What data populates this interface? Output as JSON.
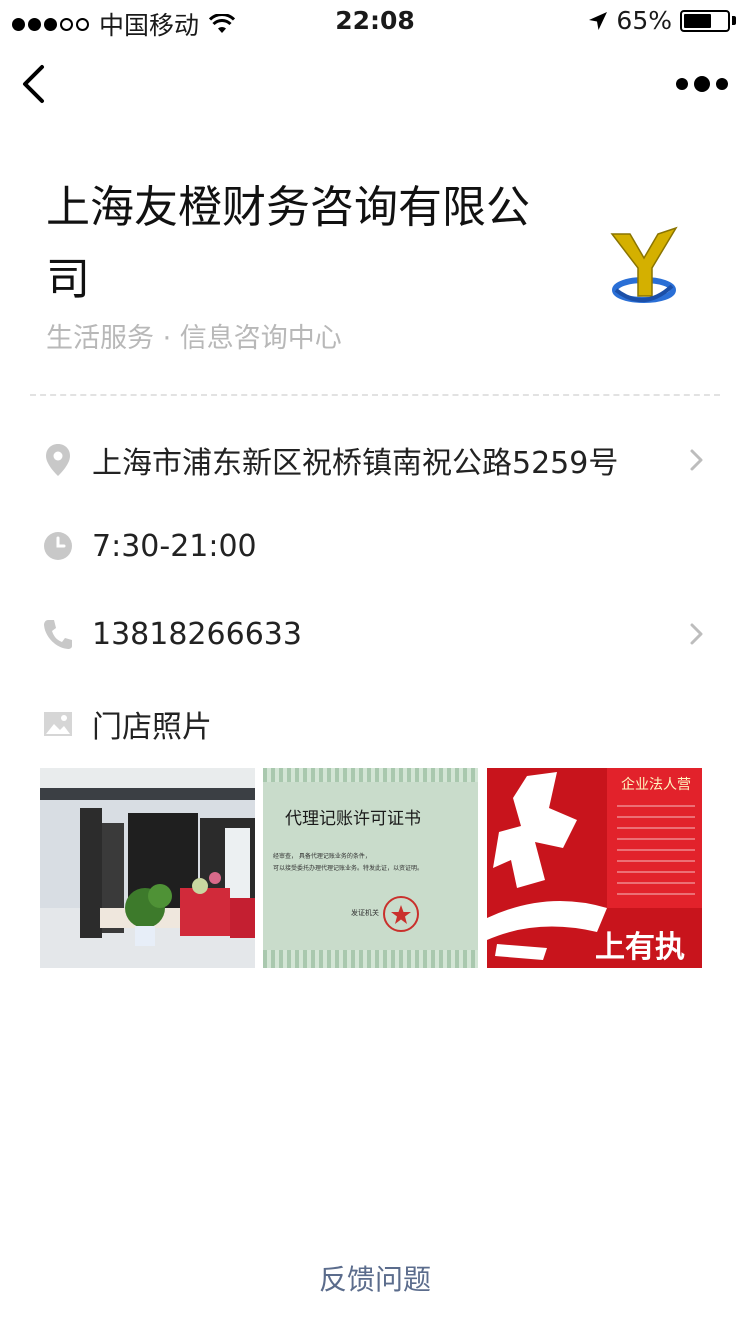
{
  "status_bar": {
    "carrier": "中国移动",
    "time": "22:08",
    "battery_percent_label": "65%",
    "battery_level": 0.65,
    "signal_bars_filled": 3,
    "signal_bars_total": 5
  },
  "business": {
    "name": "上海友橙财务咨询有限公司",
    "category": "生活服务 · 信息咨询中心",
    "logo_letter": "Y"
  },
  "details": {
    "address": "上海市浦东新区祝桥镇南祝公路5259号",
    "hours": "7:30-21:00",
    "phone": "13818266633",
    "photos_label": "门店照片"
  },
  "photos": {
    "cert_title": "代理记账许可证书",
    "cert_body_1": "经审查，                              具备代理记账业务的条件，",
    "cert_body_2": "可以接受委托办理代理记账业务。特发此证，以资证明。",
    "cert_issuer": "发证机关",
    "license_header": "企业法人营",
    "license_slogan": "上有执"
  },
  "footer": {
    "feedback_label": "反馈问题"
  },
  "colors": {
    "feedback_link": "#5b6c8c",
    "subtitle_gray": "#b8b8b8",
    "license_red": "#c8141c",
    "logo_gold": "#d4b000",
    "logo_blue": "#2a6fd6"
  }
}
